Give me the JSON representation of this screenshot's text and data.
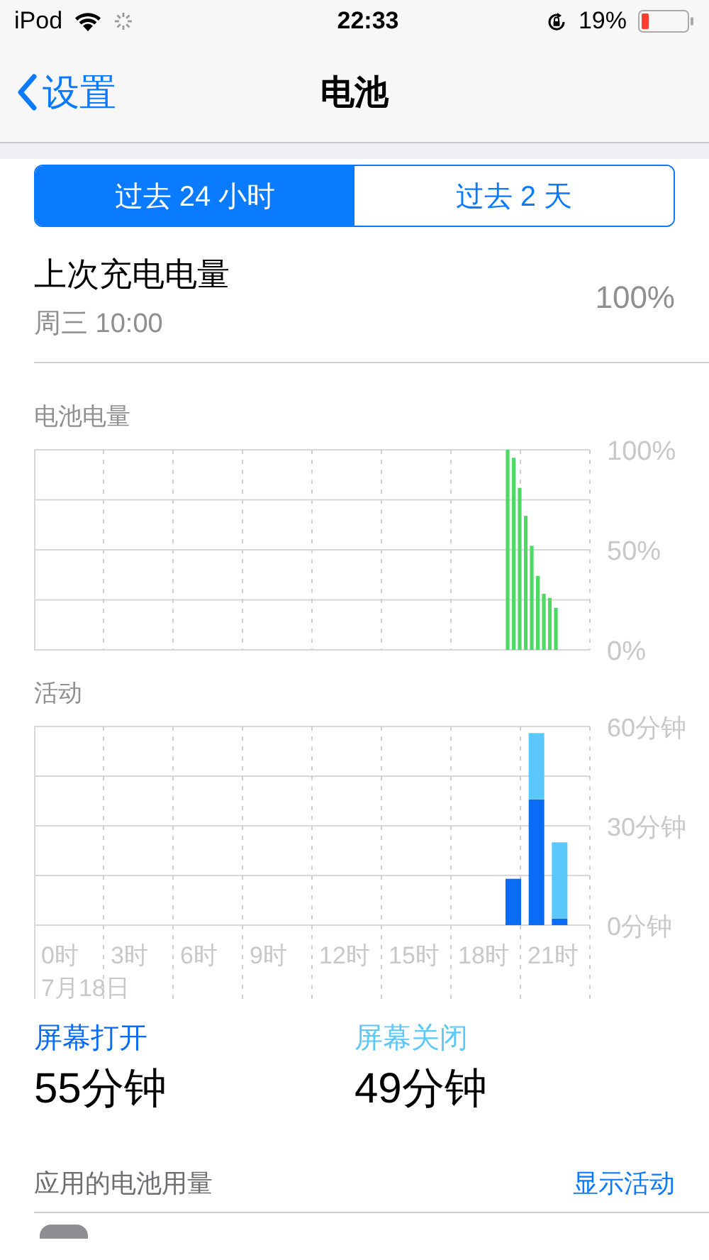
{
  "status_bar": {
    "device": "iPod",
    "time": "22:33",
    "battery_percent": "19%"
  },
  "nav": {
    "back": "设置",
    "title": "电池"
  },
  "segments": [
    {
      "label": "过去 24 小时",
      "selected": true
    },
    {
      "label": "过去 2 天",
      "selected": false
    }
  ],
  "last_charge": {
    "title": "上次充电电量",
    "time": "周三 10:00",
    "value": "100%"
  },
  "battery_chart": {
    "title": "电池电量",
    "chart_data": {
      "type": "bar",
      "categories": [
        null,
        null,
        null,
        null,
        null,
        null,
        null,
        null,
        null
      ],
      "series": [
        {
          "color": "#4cd964",
          "values": [
            100,
            96,
            81,
            67,
            52,
            37,
            28,
            26,
            21
          ]
        }
      ],
      "ylim": [
        0,
        100
      ],
      "yticks": [
        {
          "value": 0,
          "label": "0%"
        },
        {
          "value": 50,
          "label": "50%"
        },
        {
          "value": 100,
          "label": "100%"
        }
      ]
    }
  },
  "activity_chart": {
    "title": "活动",
    "hour_labels": [
      "0时",
      "3时",
      "6时",
      "9时",
      "12时",
      "15时",
      "18时",
      "21时"
    ],
    "date": "7月18日",
    "chart_data": {
      "type": "bar",
      "stacked": true,
      "categories": [
        null,
        null,
        null
      ],
      "ylim": [
        0,
        60
      ],
      "yticks": [
        {
          "value": 0,
          "label": "0分钟"
        },
        {
          "value": 30,
          "label": "30分钟"
        },
        {
          "value": 60,
          "label": "60分钟"
        }
      ],
      "series": [
        {
          "color": "#0a6cf5",
          "values": [
            14,
            38,
            2
          ]
        },
        {
          "color": "#5ac8fa",
          "values": [
            0,
            20,
            23
          ]
        }
      ]
    }
  },
  "usage": [
    {
      "label": "屏幕打开",
      "value": "55分钟",
      "color": "#0a6cf5"
    },
    {
      "label": "屏幕关闭",
      "value": "49分钟",
      "color": "#5ac8fa"
    }
  ],
  "app_usage": {
    "title": "应用的电池用量",
    "action": "显示活动"
  }
}
